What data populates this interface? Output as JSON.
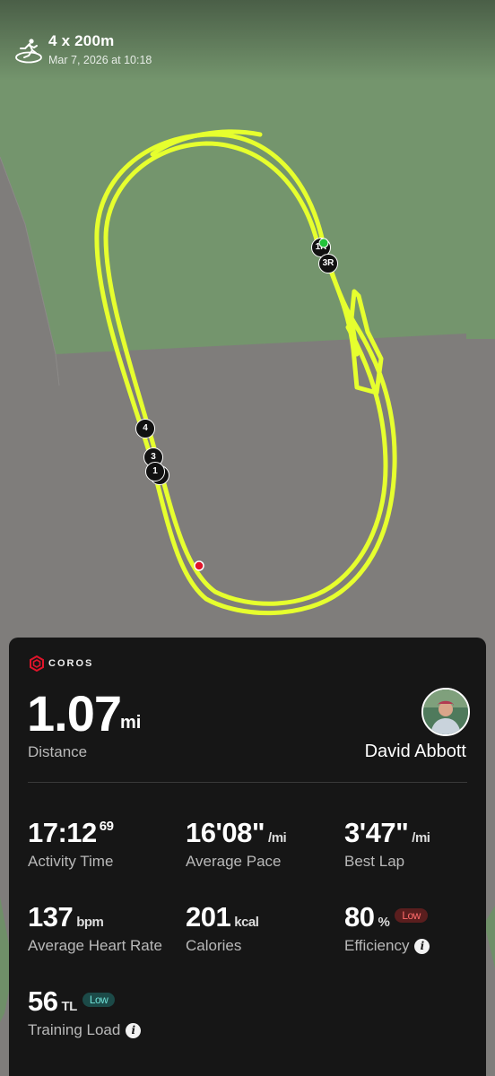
{
  "header": {
    "activity_icon": "track-run-icon",
    "title": "4 x 200m",
    "datetime": "Mar 7, 2026 at 10:18"
  },
  "map": {
    "route_color": "#e6ff2e",
    "start_color": "#22c23a",
    "end_color": "#e0142a",
    "markers": [
      "1R",
      "3R",
      "4",
      "3",
      "1"
    ]
  },
  "summary": {
    "brand": "COROS",
    "distance_value": "1.07",
    "distance_unit": "mi",
    "distance_label": "Distance",
    "user_name": "David Abbott",
    "avatar_icon": "user-avatar",
    "stats": {
      "activity_time": {
        "value": "17:12",
        "sup": "69",
        "label": "Activity Time"
      },
      "average_pace": {
        "value": "16'08\"",
        "unit": "/mi",
        "label": "Average Pace"
      },
      "best_lap": {
        "value": "3'47\"",
        "unit": "/mi",
        "label": "Best Lap"
      },
      "avg_hr": {
        "value": "137",
        "unit": "bpm",
        "label": "Average Heart Rate"
      },
      "calories": {
        "value": "201",
        "unit": "kcal",
        "label": "Calories"
      },
      "efficiency": {
        "value": "80",
        "unit": "%",
        "badge": "Low",
        "label": "Efficiency"
      },
      "training_load": {
        "value": "56",
        "unit": "TL",
        "badge": "Low",
        "label": "Training Load"
      }
    },
    "colors": {
      "badge_low_red": "#ff6b6b",
      "badge_low_teal": "#6fe0d6"
    }
  }
}
